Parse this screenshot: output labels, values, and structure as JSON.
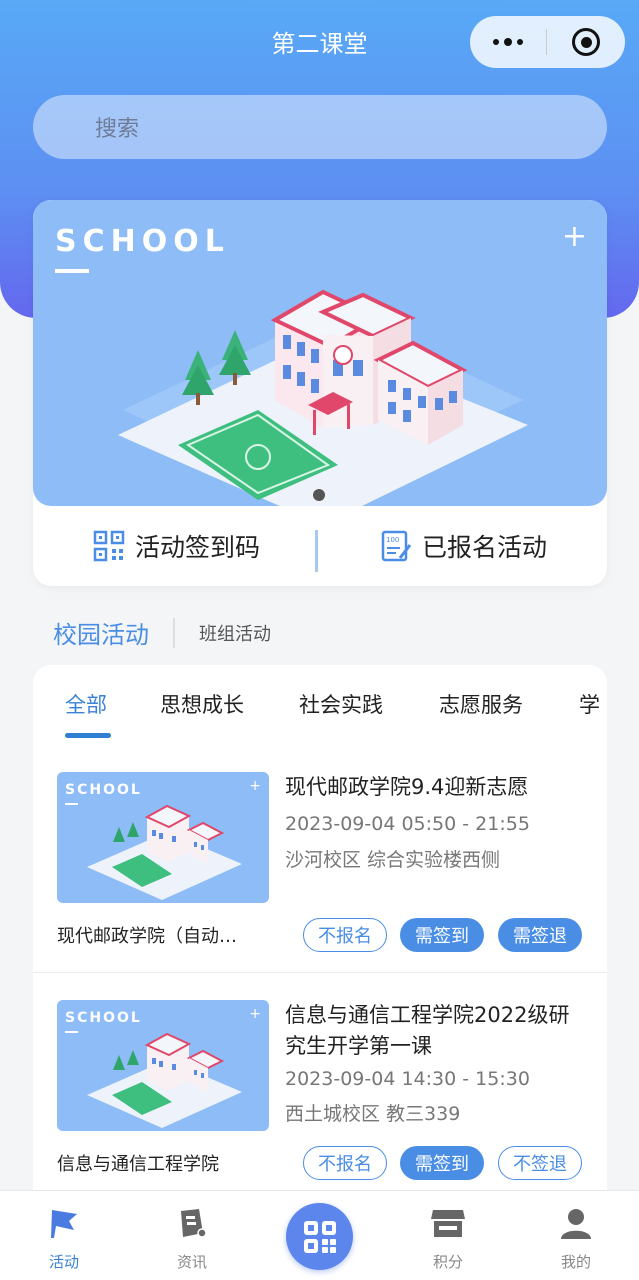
{
  "nav": {
    "title": "第二课堂"
  },
  "search": {
    "placeholder": "搜索"
  },
  "banner": {
    "word": "SCHOOL",
    "plus": "+"
  },
  "quick_actions": [
    {
      "label": "活动签到码",
      "icon": "qr-code-icon"
    },
    {
      "label": "已报名活动",
      "icon": "clipboard-icon"
    }
  ],
  "section_tabs": {
    "campus": "校园活动",
    "class": "班组活动"
  },
  "categories": [
    "全部",
    "思想成长",
    "社会实践",
    "志愿服务",
    "学"
  ],
  "activities": [
    {
      "title": "现代邮政学院9.4迎新志愿",
      "time": "2023-09-04 05:50 - 21:55",
      "place": "沙河校区 综合实验楼西侧",
      "org": "现代邮政学院（自动…",
      "thumb_word": "SCHOOL",
      "buttons": [
        "不报名",
        "需签到",
        "需签退"
      ]
    },
    {
      "title": "信息与通信工程学院2022级研究生开学第一课",
      "time": "2023-09-04 14:30 - 15:30",
      "place": "西土城校区 教三339",
      "org": "信息与通信工程学院",
      "thumb_word": "SCHOOL",
      "buttons": [
        "不报名",
        "需签到",
        "不签退"
      ]
    }
  ],
  "tabbar": [
    {
      "label": "活动",
      "icon": "flag-icon"
    },
    {
      "label": "资讯",
      "icon": "news-icon"
    },
    {
      "label": "",
      "icon": "scan-qr-icon"
    },
    {
      "label": "积分",
      "icon": "store-icon"
    },
    {
      "label": "我的",
      "icon": "user-icon"
    }
  ],
  "colors": {
    "primary": "#4a8de4",
    "banner": "#8dbcf7",
    "header_top": "#58a9f6",
    "header_bottom": "#6468ee"
  }
}
